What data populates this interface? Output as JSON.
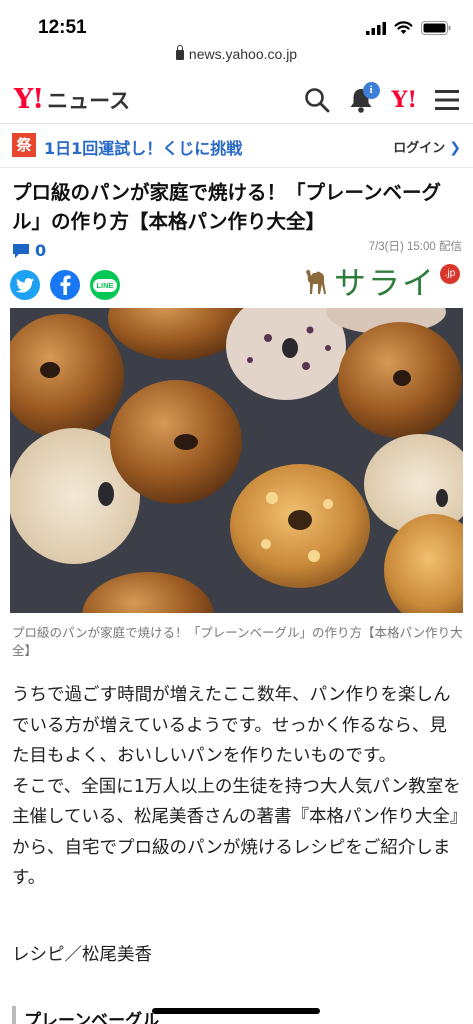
{
  "status": {
    "time": "12:51",
    "url": "news.yahoo.co.jp"
  },
  "header": {
    "logo_mark": "Y!",
    "logo_text": "ニュース",
    "notification_badge": "i",
    "yahoo_mark": "Y!"
  },
  "promo": {
    "badge": "祭",
    "text": "1日1回運試し！くじに挑戦",
    "login": "ログイン"
  },
  "article": {
    "title": "プロ級のパンが家庭で焼ける！「プレーンベーグル」の作り方【本格パン作り大全】",
    "comment_count": "0",
    "date": "7/3(日) 15:00 配信",
    "publisher": "サライ",
    "publisher_suffix": ".jp",
    "share": {
      "line": "LINE"
    },
    "image_caption": "プロ級のパンが家庭で焼ける！「プレーンベーグル」の作り方【本格パン作り大全】",
    "paragraph1": "うちで過ごす時間が増えたここ数年、パン作りを楽しんでいる方が増えているようです。せっかく作るなら、見た目もよく、おいしいパンを作りたいものです。",
    "paragraph2": "そこで、全国に1万人以上の生徒を持つ大人気パン教室を主催している、松尾美香さんの著書『本格パン作り大全』から、自宅でプロ級のパンが焼けるレシピをご紹介します。",
    "signature": "レシピ／松尾美香",
    "section_heading": "プレーンベーグル"
  },
  "colors": {
    "yahoo_red": "#ff0033",
    "link_blue": "#2869c7",
    "twitter": "#1da1f2",
    "facebook": "#1877f2",
    "line": "#06c755",
    "serai_green": "#2e7d3a"
  }
}
